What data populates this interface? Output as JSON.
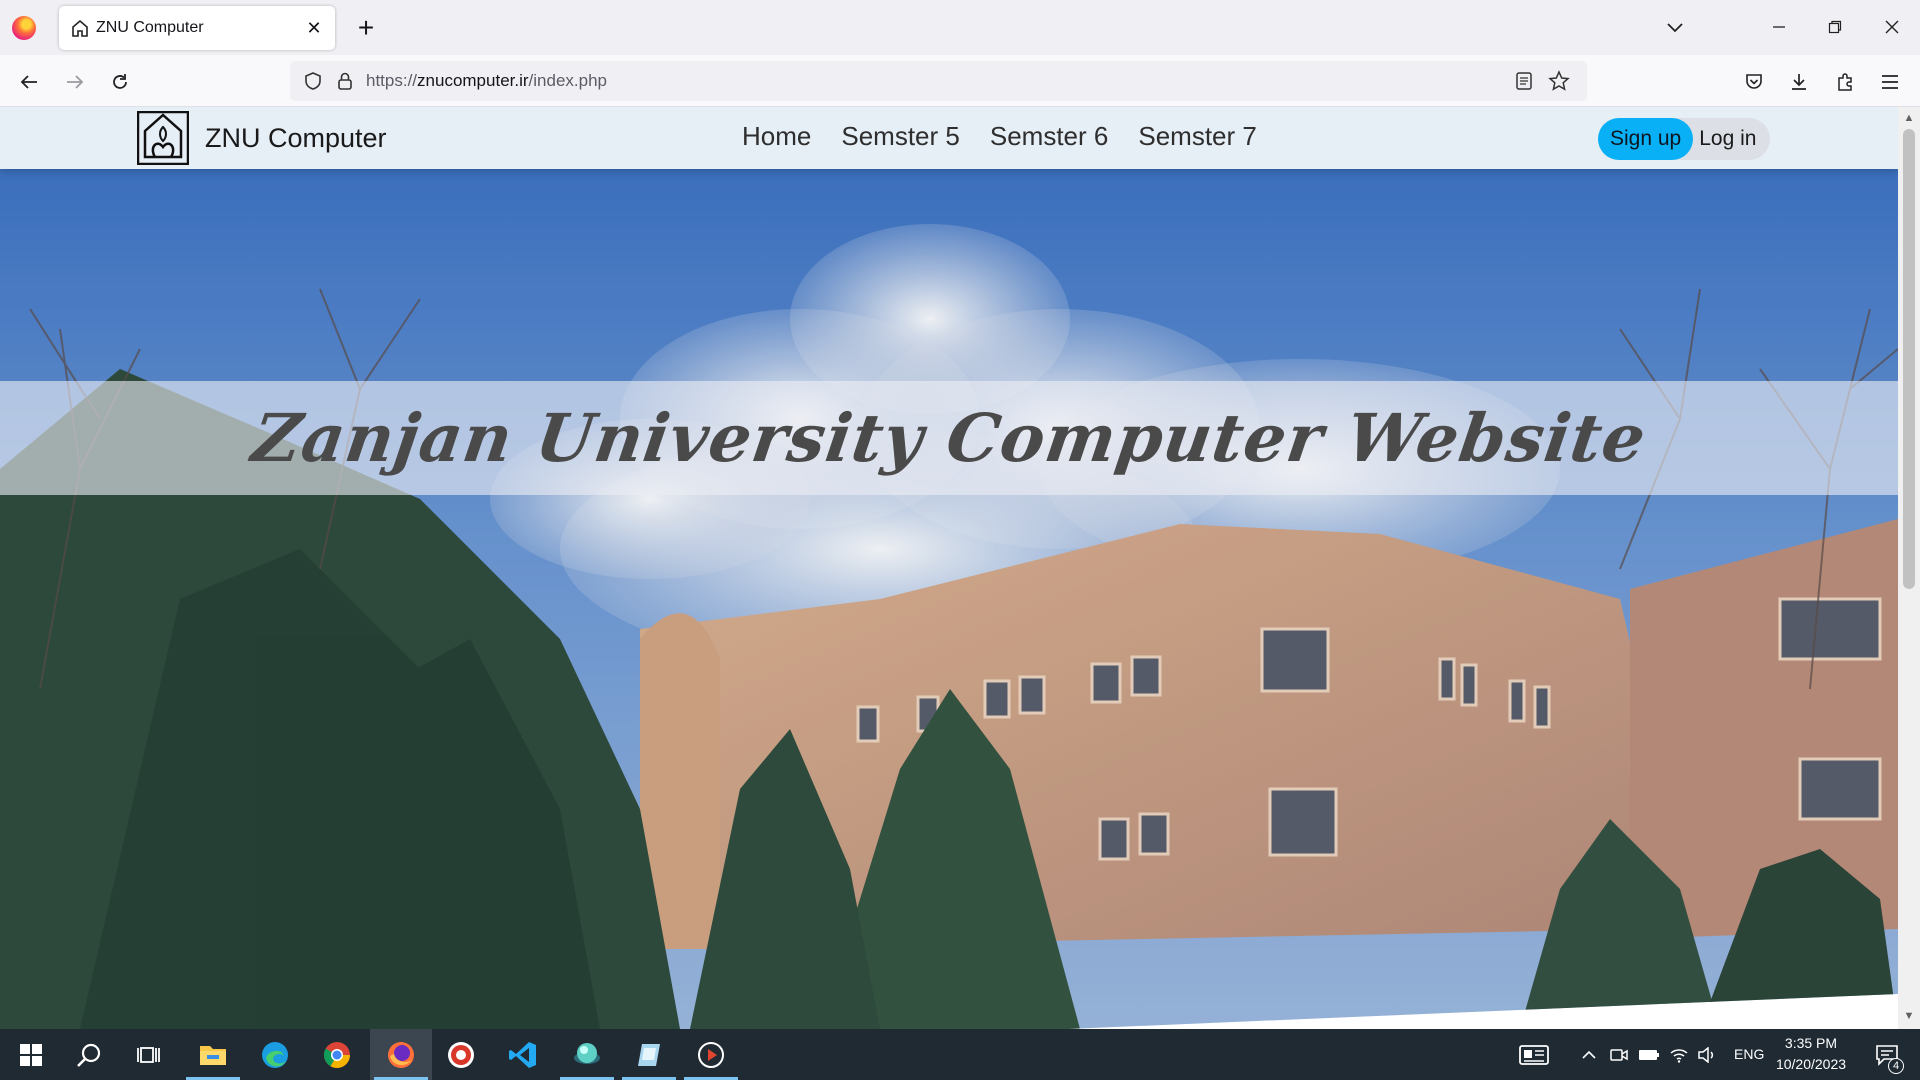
{
  "browser": {
    "tab_title": "ZNU Computer",
    "url_scheme": "https://",
    "url_host": "znucomputer.ir",
    "url_path": "/index.php"
  },
  "site": {
    "brand_name": "ZNU Computer",
    "menu": [
      {
        "label": "Home"
      },
      {
        "label": "Semster 5"
      },
      {
        "label": "Semster 6"
      },
      {
        "label": "Semster 7"
      }
    ],
    "signup_label": "Sign up",
    "login_label": "Log in",
    "hero_title": "Zanjan University Computer Website"
  },
  "taskbar": {
    "language": "ENG",
    "time": "3:35 PM",
    "date": "10/20/2023",
    "notification_count": "4"
  },
  "colors": {
    "header_bg": "#e6eef6",
    "signup_bg": "#0ab0f5",
    "taskbar_bg": "#1f2a33"
  }
}
